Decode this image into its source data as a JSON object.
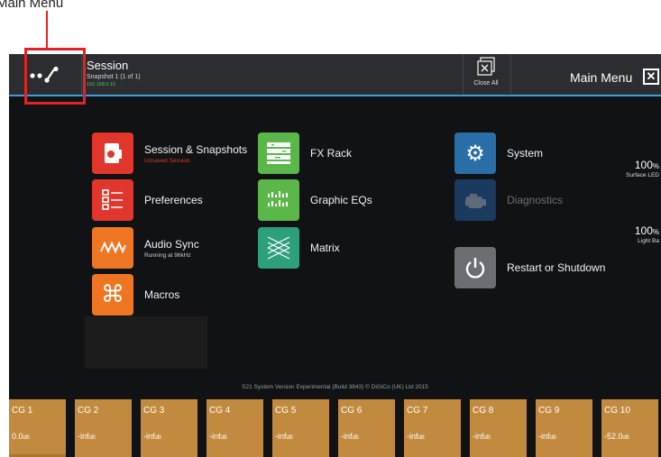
{
  "annotation": {
    "label": "Main Menu"
  },
  "topbar": {
    "session_title": "Session",
    "session_subtitle": "Snapshot 1 (1 of 1)",
    "session_ip": "192.168.0.15",
    "close_all_label": "Close All",
    "main_menu_title": "Main Menu",
    "close_icon": "close-icon",
    "accent_color": "#3a9cd9"
  },
  "menu": {
    "session_snapshots": {
      "label": "Session & Snapshots",
      "sub": "Unsaved Session",
      "sub_color": "#e0362c"
    },
    "preferences": {
      "label": "Preferences"
    },
    "audio_sync": {
      "label": "Audio Sync",
      "sub": "Running at 96kHz"
    },
    "macros": {
      "label": "Macros"
    },
    "fx_rack": {
      "label": "FX Rack"
    },
    "graphic_eqs": {
      "label": "Graphic EQs"
    },
    "matrix": {
      "label": "Matrix"
    },
    "system": {
      "label": "System"
    },
    "diagnostics": {
      "label": "Diagnostics"
    },
    "restart": {
      "label": "Restart or Shutdown"
    }
  },
  "brightness": {
    "surface_led": {
      "value": "100",
      "unit": "%",
      "label": "Surface LED"
    },
    "light_bar": {
      "value": "100",
      "unit": "%",
      "label": "Light Ba"
    }
  },
  "version": "S21 System Version Experimental (Build 3843) © DiGiCo (UK) Ltd 2015",
  "control_groups": [
    {
      "name": "CG 1",
      "value": "0.0",
      "unit": "dB"
    },
    {
      "name": "CG 2",
      "value": "-inf",
      "unit": "dB"
    },
    {
      "name": "CG 3",
      "value": "-inf",
      "unit": "dB"
    },
    {
      "name": "CG 4",
      "value": "-inf",
      "unit": "dB"
    },
    {
      "name": "CG 5",
      "value": "-inf",
      "unit": "dB"
    },
    {
      "name": "CG 6",
      "value": "-inf",
      "unit": "dB"
    },
    {
      "name": "CG 7",
      "value": "-inf",
      "unit": "dB"
    },
    {
      "name": "CG 8",
      "value": "-inf",
      "unit": "dB"
    },
    {
      "name": "CG 9",
      "value": "-inf",
      "unit": "dB"
    },
    {
      "name": "CG 10",
      "value": "-52.0",
      "unit": "dB"
    }
  ]
}
